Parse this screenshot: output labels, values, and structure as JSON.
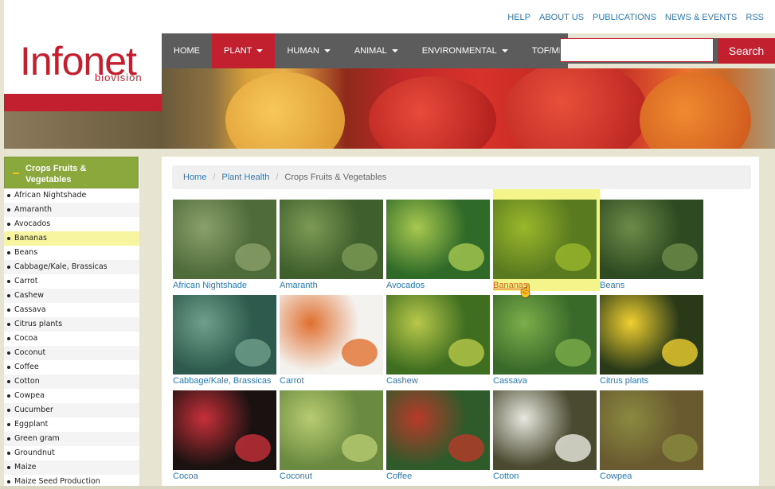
{
  "top_links": [
    "HELP",
    "ABOUT US",
    "PUBLICATIONS",
    "NEWS & EVENTS",
    "RSS"
  ],
  "logo": {
    "main": "Infonet",
    "sub": "biovision"
  },
  "nav": [
    {
      "label": "HOME",
      "dropdown": false,
      "active": false
    },
    {
      "label": "PLANT",
      "dropdown": true,
      "active": true
    },
    {
      "label": "HUMAN",
      "dropdown": true,
      "active": false
    },
    {
      "label": "ANIMAL",
      "dropdown": true,
      "active": false
    },
    {
      "label": "ENVIRONMENTAL",
      "dropdown": true,
      "active": false
    },
    {
      "label": "TOF/MKM",
      "dropdown": false,
      "active": false
    }
  ],
  "search": {
    "value": "",
    "button": "Search"
  },
  "sidebar": {
    "title": "Crops Fruits & Vegetables",
    "items": [
      "African Nightshade",
      "Amaranth",
      "Avocados",
      "Bananas",
      "Beans",
      "Cabbage/Kale, Brassicas",
      "Carrot",
      "Cashew",
      "Cassava",
      "Citrus plants",
      "Cocoa",
      "Coconut",
      "Coffee",
      "Cotton",
      "Cowpea",
      "Cucumber",
      "Eggplant",
      "Green gram",
      "Groundnut",
      "Maize",
      "Maize Seed Production"
    ],
    "selected": "Bananas"
  },
  "breadcrumb": {
    "home": "Home",
    "parent": "Plant Health",
    "current": "Crops Fruits & Vegetables"
  },
  "tiles": [
    {
      "label": "African Nightshade",
      "c1": "#4f6b3a",
      "c2": "#8aa06a"
    },
    {
      "label": "Amaranth",
      "c1": "#3f5f2c",
      "c2": "#7d9a55"
    },
    {
      "label": "Avocados",
      "c1": "#2f6a28",
      "c2": "#a8c850"
    },
    {
      "label": "Bananas",
      "c1": "#5a7a20",
      "c2": "#9ab82a"
    },
    {
      "label": "Beans",
      "c1": "#2e4a22",
      "c2": "#6d8c48"
    },
    {
      "label": "Cabbage/Kale, Brassicas",
      "c1": "#2d5a4c",
      "c2": "#6fa08c"
    },
    {
      "label": "Carrot",
      "c1": "#f4f2ee",
      "c2": "#e07030"
    },
    {
      "label": "Cashew",
      "c1": "#3f6e20",
      "c2": "#b8c84a"
    },
    {
      "label": "Cassava",
      "c1": "#3a6a2a",
      "c2": "#7cae4a"
    },
    {
      "label": "Citrus plants",
      "c1": "#2a3a18",
      "c2": "#f0d030"
    },
    {
      "label": "Cocoa",
      "c1": "#1a1210",
      "c2": "#c8303a"
    },
    {
      "label": "Coconut",
      "c1": "#6a8a40",
      "c2": "#b8cc70"
    },
    {
      "label": "Coffee",
      "c1": "#2f5a2a",
      "c2": "#b83a2a"
    },
    {
      "label": "Cotton",
      "c1": "#4a4a30",
      "c2": "#e8e8e0"
    },
    {
      "label": "Cowpea",
      "c1": "#6a5a30",
      "c2": "#8a8a40"
    }
  ],
  "hover_tile": "Bananas"
}
